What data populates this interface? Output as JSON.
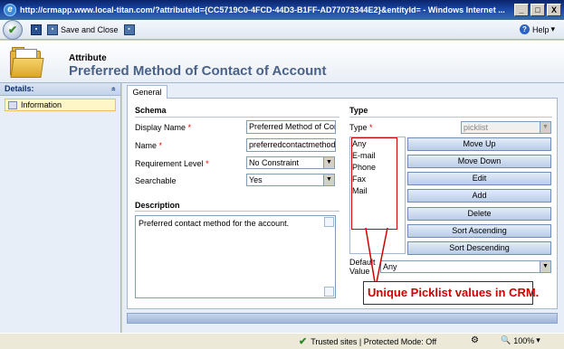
{
  "window": {
    "title": "http://crmapp.www.local-titan.com/?attributeId={CC5719C0-4FCD-44D3-B1FF-AD77073344E2}&entityId= - Windows Internet ...",
    "minimize": "_",
    "maximize": "□",
    "close": "X"
  },
  "toolbar": {
    "save_and_close": "Save and Close",
    "help": "Help",
    "help_arrow": "▾"
  },
  "header": {
    "subtitle": "Attribute",
    "title": "Preferred Method of Contact of Account"
  },
  "nav": {
    "heading": "Details:",
    "collapse": "«",
    "items": [
      {
        "label": "Information"
      }
    ]
  },
  "tabs": [
    {
      "label": "General"
    }
  ],
  "schema": {
    "section_title": "Schema",
    "display_name_label": "Display Name",
    "display_name_value": "Preferred Method of Cont",
    "name_label": "Name",
    "name_value": "preferredcontactmethodco",
    "requirement_label": "Requirement Level",
    "requirement_value": "No Constraint",
    "searchable_label": "Searchable",
    "searchable_value": "Yes",
    "required_marker": "*"
  },
  "description": {
    "section_title": "Description",
    "value": "Preferred contact method for the account."
  },
  "type": {
    "section_title": "Type",
    "type_label": "Type",
    "type_value": "picklist",
    "options": [
      "Any",
      "E-mail",
      "Phone",
      "Fax",
      "Mail"
    ],
    "buttons": [
      "Move Up",
      "Move Down",
      "Edit",
      "Add",
      "Delete",
      "Sort Ascending",
      "Sort Descending"
    ],
    "default_label_1": "Default",
    "default_label_2": "Value",
    "default_value": "Any"
  },
  "annotation": {
    "text": "Unique Picklist values in CRM."
  },
  "statusbar": {
    "trusted": "Trusted sites | Protected Mode: Off",
    "zoom": "100%",
    "zoom_arrow": "▾"
  },
  "colors": {
    "title_bar": "#0a246a",
    "header_title": "#4a6287",
    "required": "#e00000",
    "annotation": "#d00000"
  }
}
